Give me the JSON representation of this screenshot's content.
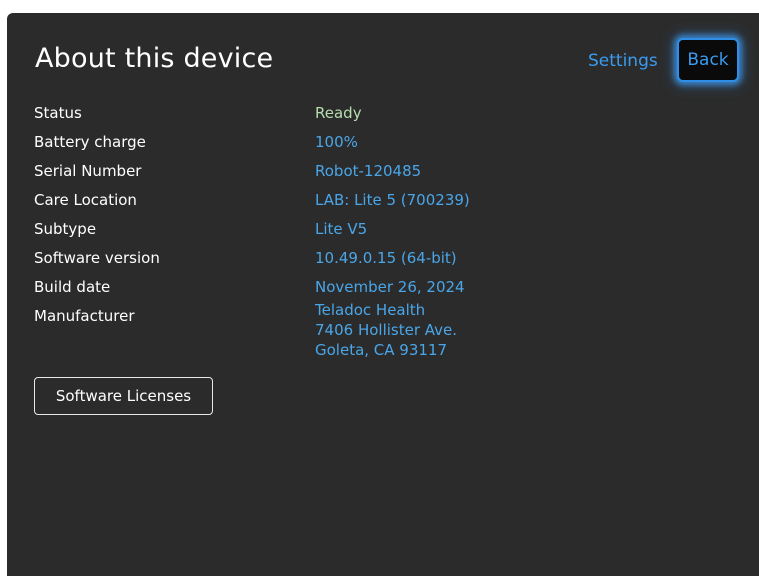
{
  "header": {
    "title": "About this device",
    "settings_label": "Settings",
    "back_label": "Back"
  },
  "info": {
    "status": {
      "label": "Status",
      "value": "Ready"
    },
    "battery": {
      "label": "Battery charge",
      "value": "100%"
    },
    "serial": {
      "label": "Serial Number",
      "value": "Robot-120485"
    },
    "care_location": {
      "label": "Care Location",
      "value": "LAB: Lite 5 (700239)"
    },
    "subtype": {
      "label": "Subtype",
      "value": "Lite V5"
    },
    "software_version": {
      "label": "Software version",
      "value": "10.49.0.15 (64-bit)"
    },
    "build_date": {
      "label": "Build date",
      "value": "November 26, 2024"
    },
    "manufacturer": {
      "label": "Manufacturer",
      "lines": [
        "Teladoc Health",
        "7406 Hollister Ave.",
        "Goleta, CA 93117"
      ]
    }
  },
  "actions": {
    "software_licenses_label": "Software Licenses"
  },
  "colors": {
    "background": "#2b2b2b",
    "accent": "#3a9bf0",
    "value_text": "#4aa6e8",
    "status_ready": "#b8ddb0"
  }
}
